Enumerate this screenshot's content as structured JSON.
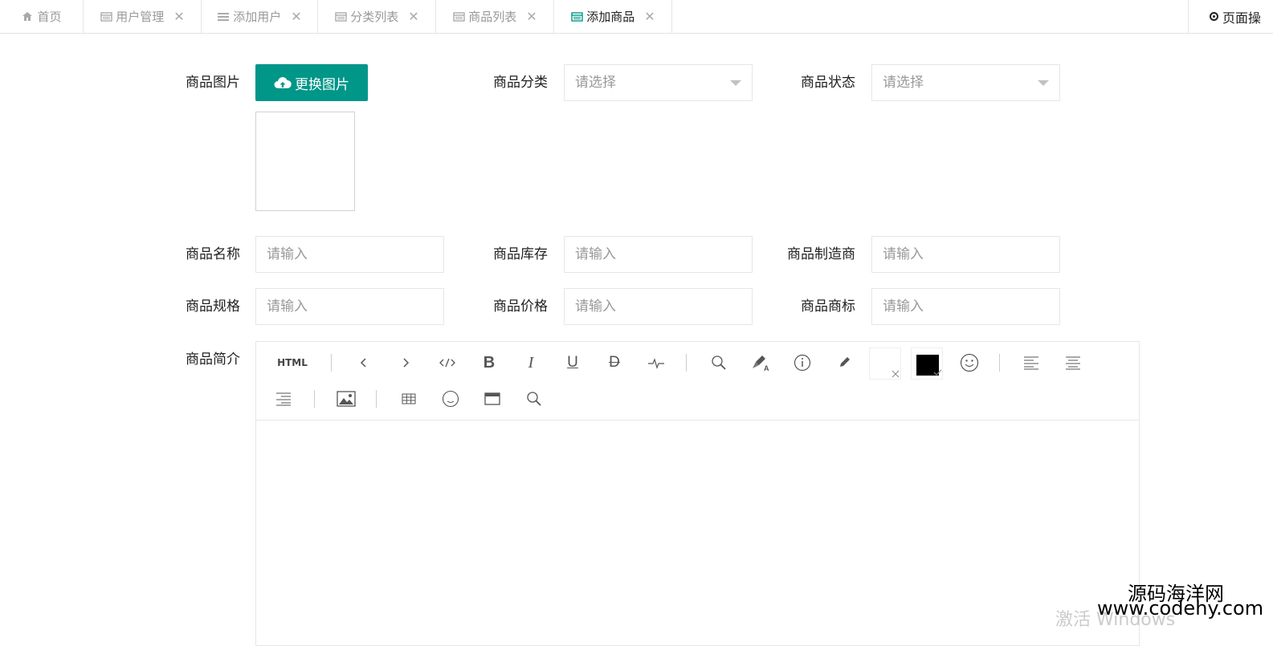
{
  "tabs": [
    {
      "label": "首页",
      "icon": "home-icon",
      "closable": false
    },
    {
      "label": "用户管理",
      "icon": "window-icon",
      "closable": true
    },
    {
      "label": "添加用户",
      "icon": "list-icon",
      "closable": true
    },
    {
      "label": "分类列表",
      "icon": "window-icon",
      "closable": true
    },
    {
      "label": "商品列表",
      "icon": "window-icon",
      "closable": true
    },
    {
      "label": "添加商品",
      "icon": "window-icon",
      "closable": true,
      "active": true
    }
  ],
  "page_op_label": "页面操",
  "form": {
    "image_label": "商品图片",
    "upload_button": "更换图片",
    "category_label": "商品分类",
    "category_placeholder": "请选择",
    "status_label": "商品状态",
    "status_placeholder": "请选择",
    "name_label": "商品名称",
    "stock_label": "商品库存",
    "manufacturer_label": "商品制造商",
    "spec_label": "商品规格",
    "price_label": "商品价格",
    "brand_label": "商品商标",
    "input_placeholder": "请输入",
    "intro_label": "商品简介"
  },
  "editor": {
    "html_button": "HTML",
    "tools": [
      "undo-icon",
      "redo-icon",
      "code-icon",
      "bold-icon",
      "italic-icon",
      "underline-icon",
      "strikethrough-icon",
      "pulse-icon",
      "search-icon",
      "clear-format-icon",
      "info-icon",
      "pen-icon",
      "bg-color-swatch",
      "font-color-swatch",
      "emoji-icon",
      "align-left-icon",
      "align-center-icon",
      "align-right-icon",
      "image-icon",
      "table-icon",
      "emoticon-icon",
      "fullscreen-icon",
      "zoom-icon"
    ]
  },
  "watermark": {
    "site_name": "源码海洋网",
    "site_url": "www.codehy.com",
    "windows_activation": "激活 Windows"
  },
  "colors": {
    "primary": "#009688",
    "border": "#e6e6e6",
    "placeholder": "#999999"
  }
}
